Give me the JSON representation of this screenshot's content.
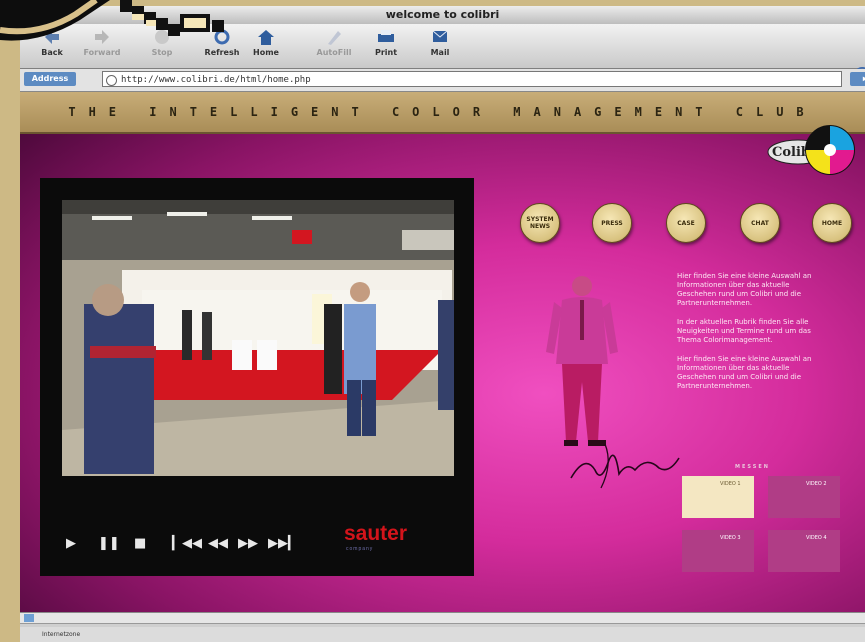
{
  "browser": {
    "window_title": "welcome to colibri",
    "toolbar": [
      {
        "label": "Back",
        "icon": "back-arrow-icon",
        "enabled": true
      },
      {
        "label": "Forward",
        "icon": "forward-arrow-icon",
        "enabled": false
      },
      {
        "label": "Stop",
        "icon": "stop-icon",
        "enabled": false
      },
      {
        "label": "Refresh",
        "icon": "refresh-icon",
        "enabled": true
      },
      {
        "label": "Home",
        "icon": "home-icon",
        "enabled": true
      },
      {
        "label": "AutoFill",
        "icon": "autofill-icon",
        "enabled": false
      },
      {
        "label": "Print",
        "icon": "print-icon",
        "enabled": true
      },
      {
        "label": "Mail",
        "icon": "mail-icon",
        "enabled": true
      }
    ],
    "address_label": "Address",
    "address_value": "http://www.colibri.de/html/home.php",
    "status_text": "Internetzone"
  },
  "page": {
    "banner_text": "THE INTELLIGENT COLOR MANAGEMENT CLUB",
    "logo_text": "Colibri",
    "nav_buttons": [
      "SYSTEM NEWS",
      "PRESS",
      "CASE",
      "CHAT",
      "HOME"
    ],
    "paragraphs": [
      "Hier finden Sie eine kleine Auswahl an Informationen über das aktuelle Geschehen rund um Colibri und die Partnerunternehmen.",
      "In der aktuellen Rubrik finden Sie alle Neuigkeiten und Termine rund um das Thema Colorimanagement.",
      "Hier finden Sie eine kleine Auswahl an Informationen über das aktuelle Geschehen rund um Colibri und die Partnerunternehmen."
    ],
    "spec_label": "MESSEN",
    "spec_tiles": [
      "VIDEO 1",
      "VIDEO 2",
      "VIDEO 3",
      "VIDEO 4"
    ],
    "player_controls": [
      "play-icon",
      "pause-icon",
      "stop-icon",
      "skip-back-icon",
      "rewind-icon",
      "fast-forward-icon",
      "skip-forward-icon"
    ],
    "sponsor": "sauter",
    "sponsor_sub": "company",
    "colors": {
      "accent": "#d42c9c",
      "banner": "#c8ad78",
      "button": "#e8d39a"
    }
  }
}
